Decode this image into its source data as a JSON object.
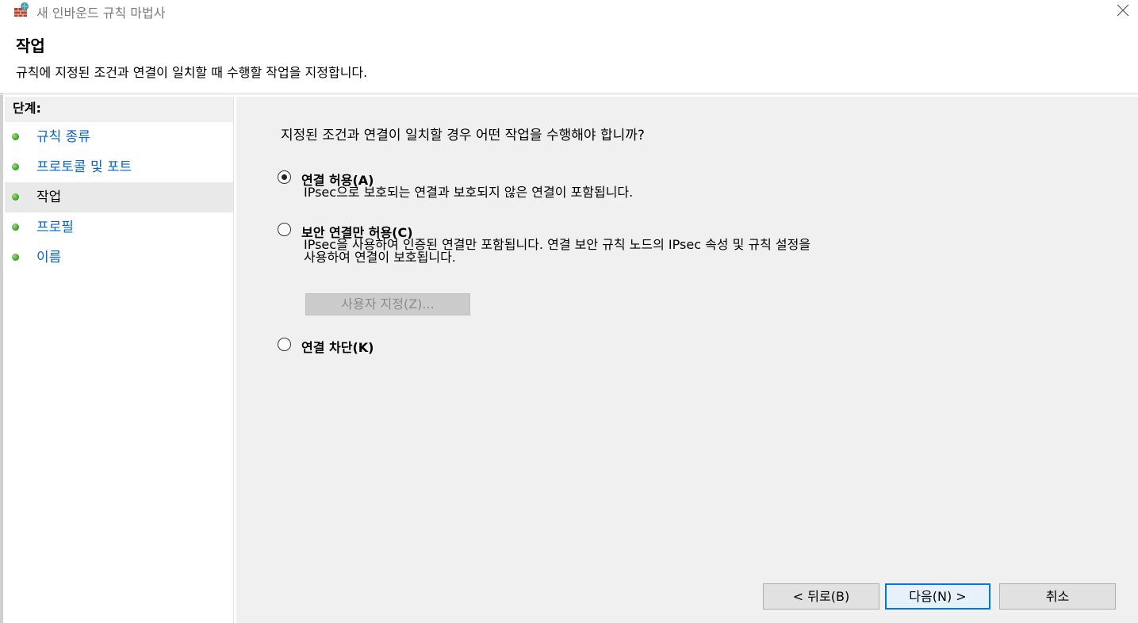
{
  "window": {
    "title": "새 인바운드 규칙 마법사"
  },
  "header": {
    "title": "작업",
    "subtitle": "규칙에 지정된 조건과 연결이 일치할 때 수행할 작업을 지정합니다."
  },
  "sidebar": {
    "heading": "단계:",
    "items": [
      {
        "label": "규칙 종류",
        "current": false
      },
      {
        "label": "프로토콜 및 포트",
        "current": false
      },
      {
        "label": "작업",
        "current": true
      },
      {
        "label": "프로필",
        "current": false
      },
      {
        "label": "이름",
        "current": false
      }
    ]
  },
  "main": {
    "question": "지정된 조건과 연결이 일치할 경우 어떤 작업을 수행해야 합니까?",
    "options": [
      {
        "label": "연결 허용(A)",
        "selected": true,
        "description_lines": [
          "IPsec으로 보호되는 연결과 보호되지 않은 연결이 포함됩니다."
        ]
      },
      {
        "label": "보안 연결만 허용(C)",
        "selected": false,
        "description_lines": [
          "IPsec을 사용하여 인증된 연결만 포함됩니다. 연결 보안 규칙 노드의 IPsec 속성 및 규칙 설정을",
          "사용하여 연결이 보호됩니다."
        ]
      },
      {
        "label": "연결 차단(K)",
        "selected": false,
        "description_lines": []
      }
    ],
    "customize_button": "사용자 지정(Z)..."
  },
  "footer": {
    "back_button": "< 뒤로(B)",
    "next_button": "다음(N) >",
    "cancel_button": "취소"
  },
  "icons": {
    "app": "firewall-icon",
    "close": "close-icon",
    "step_bullet": "green-dot-icon"
  },
  "colors": {
    "link": "#0a66c2",
    "panel_bg": "#f0f0f0",
    "accent": "#0078d7"
  }
}
